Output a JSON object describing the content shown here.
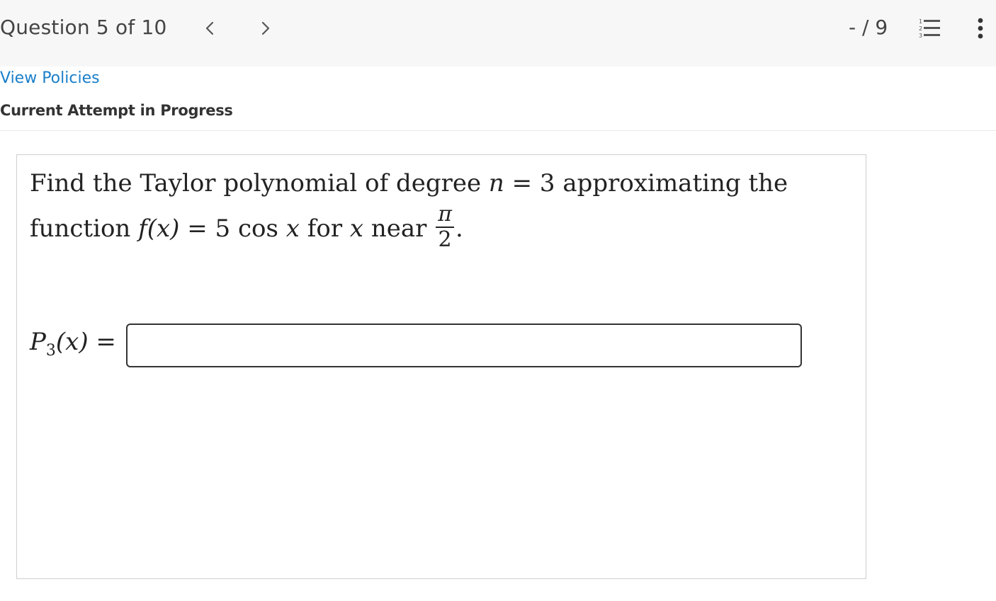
{
  "header": {
    "question_counter": "Question 5 of 10",
    "score": "- / 9",
    "prev_icon": "chevron-left-icon",
    "next_icon": "chevron-right-icon",
    "list_icon": "numbered-list-icon",
    "more_icon": "vertical-ellipsis-icon"
  },
  "links": {
    "view_policies": "View Policies"
  },
  "status": {
    "attempt": "Current Attempt in Progress"
  },
  "question": {
    "line1_text": "Find the Taylor polynomial of degree ",
    "line1_var": "n",
    "line1_eq": " = 3 approximating the",
    "line2_function": "function ",
    "line2_f": "f",
    "line2_fx": "(x)",
    "line2_rhs": " = 5 cos ",
    "line2_x": "x",
    "line2_for": " for ",
    "line2_x2": "x",
    "line2_near": " near ",
    "frac_num": "π",
    "frac_den": "2",
    "period": "."
  },
  "answer": {
    "label_p": "P",
    "label_sub": "3",
    "label_rest": "(x) =",
    "value": "",
    "placeholder": ""
  },
  "colors": {
    "link": "#1a7fc9",
    "topbar_bg": "#f7f7f7",
    "text": "#333333"
  }
}
